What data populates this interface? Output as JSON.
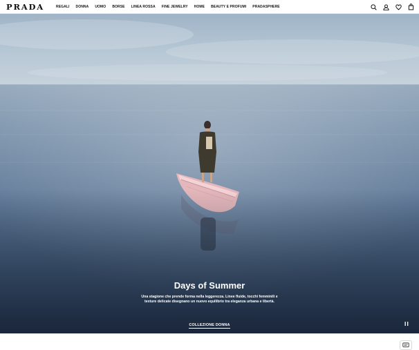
{
  "header": {
    "logo": "PRADA",
    "nav": [
      "REGALI",
      "DONNA",
      "UOMO",
      "BORSE",
      "LINEA ROSSA",
      "FINE JEWELRY",
      "HOME",
      "BEAUTY E PROFUMI",
      "PRADASPHERE"
    ],
    "icons": [
      "search-icon",
      "user-icon",
      "heart-icon",
      "shopping-bag-icon"
    ]
  },
  "hero": {
    "title": "Days of Summer",
    "description": "Una stagione che prende forma nella leggerezza. Linee fluide, tocchi femminili e texture delicate disegnano un nuovo equilibrio tra eleganza urbana e libertà.",
    "cta": "COLLEZIONE DONNA",
    "pause_icon": "pause-icon"
  },
  "footer": {
    "chat_icon": "chat-icon"
  },
  "colors": {
    "accent": "#111111",
    "sky": "#a9bccd",
    "sea": "#4f6a8a",
    "boat": "#e2b6ba"
  }
}
